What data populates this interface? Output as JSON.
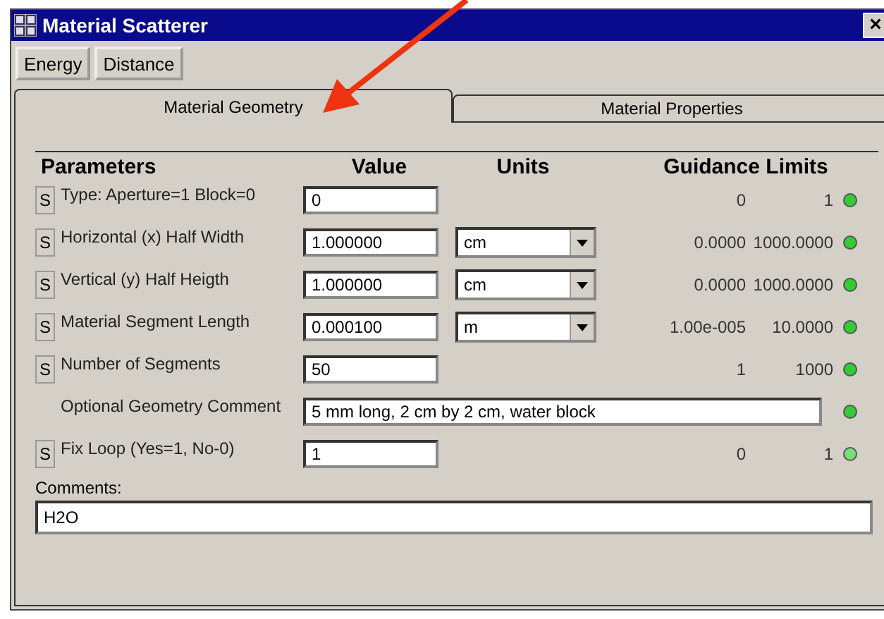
{
  "window": {
    "title": "Material Scatterer",
    "close": "×"
  },
  "toolbar": [
    "Energy",
    "Distance"
  ],
  "tabs": [
    {
      "label": "Material Geometry",
      "selected": true
    },
    {
      "label": "Material Properties",
      "selected": false
    }
  ],
  "table": {
    "columns": [
      "Parameters",
      "Value",
      "Units",
      "Guidance Limits"
    ],
    "rows": [
      {
        "kind": "param",
        "button": "S",
        "label": "Type: Aperture=1 Block=0",
        "value": "0",
        "min": "0",
        "max": "1",
        "color": "#33cc33"
      },
      {
        "kind": "param",
        "button": "S",
        "label": "Horizontal (x) Half Width",
        "value": "1.000000",
        "unit": "cm",
        "min": "0.0000",
        "max": "1000.0000",
        "color": "#33cc33"
      },
      {
        "kind": "param",
        "button": "S",
        "label": "Vertical (y) Half Heigth",
        "value": "1.000000",
        "unit": "cm",
        "min": "0.0000",
        "max": "1000.0000",
        "color": "#33cc33"
      },
      {
        "kind": "param",
        "button": "S",
        "label": "Material Segment Length",
        "value": "0.000100",
        "unit": "m",
        "min": "1.00e-005",
        "max": "10.0000",
        "color": "#33cc33"
      },
      {
        "kind": "param",
        "button": "S",
        "label": "Number of Segments",
        "value": "50",
        "min": "1",
        "max": "1000",
        "color": "#33cc33"
      },
      {
        "kind": "comment",
        "label": "Optional Geometry Comment",
        "value": "5 mm long, 2 cm by 2 cm, water block",
        "color": "#33cc33"
      },
      {
        "kind": "param",
        "button": "S",
        "label": "Fix Loop (Yes=1, No-0)",
        "value": "1",
        "min": "0",
        "max": "1",
        "color": "#77dd77"
      }
    ]
  },
  "comments": {
    "label": "Comments:",
    "value": "H2O"
  }
}
